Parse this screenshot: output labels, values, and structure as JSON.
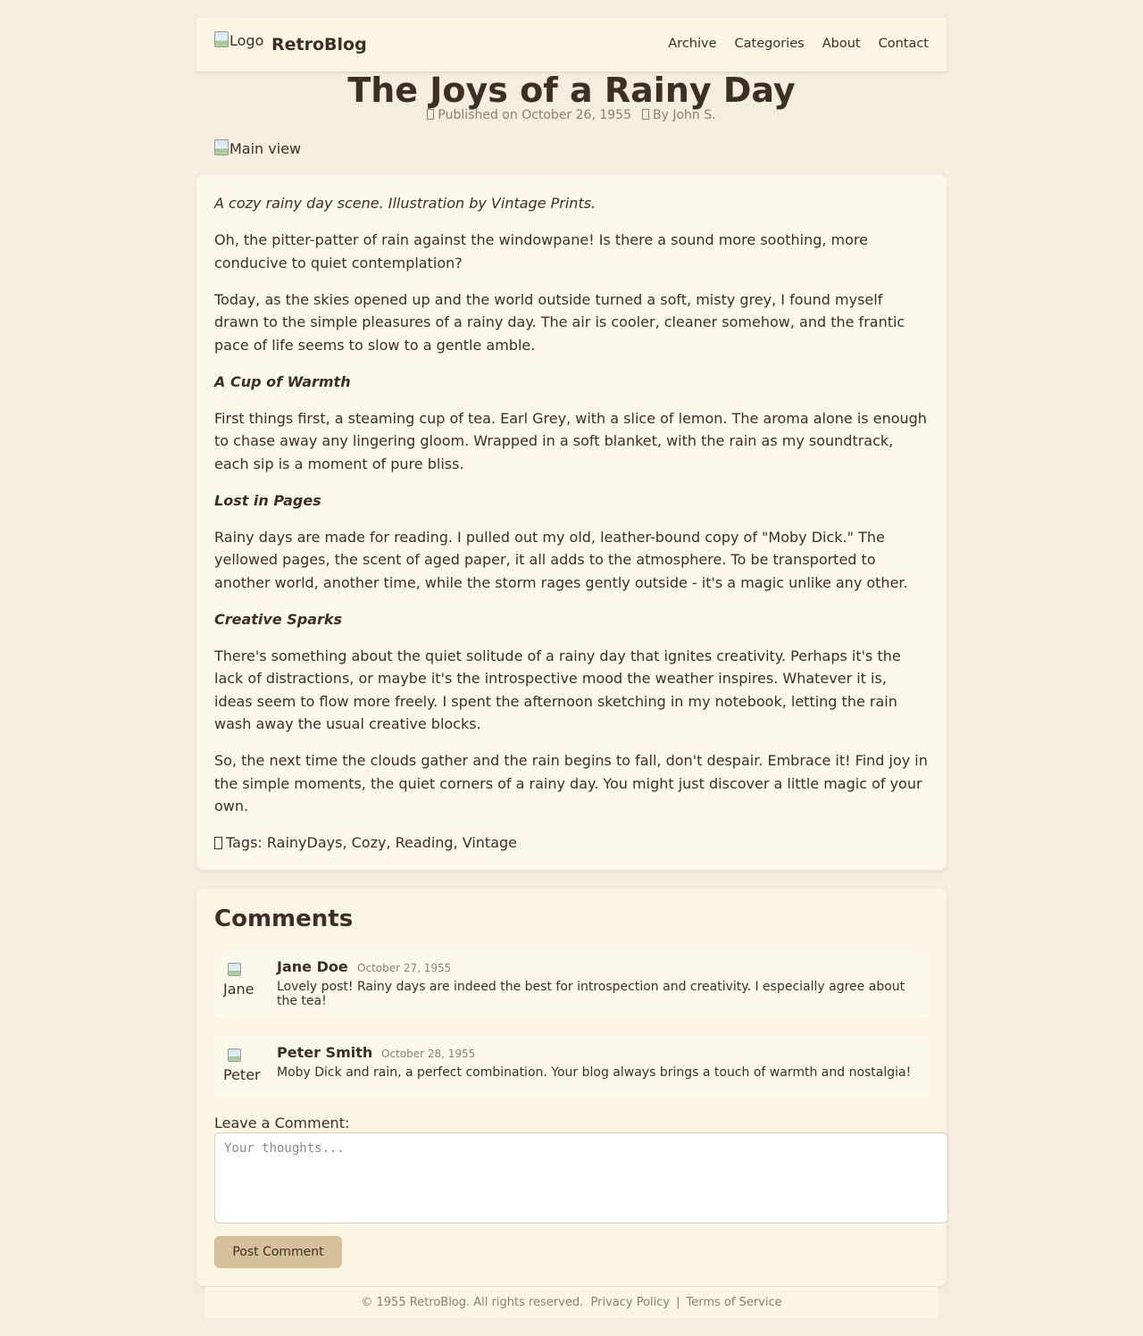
{
  "header": {
    "logo_alt": "Logo",
    "brand": "RetroBlog",
    "nav": [
      "Archive",
      "Categories",
      "About",
      "Contact"
    ]
  },
  "post": {
    "title": "The Joys of a Rainy Day",
    "published": "Published on October 26, 1955",
    "author": "By John S.",
    "main_image_alt": "Main view",
    "caption": "A cozy rainy day scene. Illustration by Vintage Prints.",
    "p1": "Oh, the pitter-patter of rain against the windowpane! Is there a sound more soothing, more conducive to quiet contemplation?",
    "p2": "Today, as the skies opened up and the world outside turned a soft, misty grey, I found myself drawn to the simple pleasures of a rainy day. The air is cooler, cleaner somehow, and the frantic pace of life seems to slow to a gentle amble.",
    "h1": "A Cup of Warmth",
    "p3": "First things first, a steaming cup of tea. Earl Grey, with a slice of lemon. The aroma alone is enough to chase away any lingering gloom. Wrapped in a soft blanket, with the rain as my soundtrack, each sip is a moment of pure bliss.",
    "h2": "Lost in Pages",
    "p4": "Rainy days are made for reading. I pulled out my old, leather-bound copy of \"Moby Dick.\" The yellowed pages, the scent of aged paper, it all adds to the atmosphere. To be transported to another world, another time, while the storm rages gently outside - it's a magic unlike any other.",
    "h3": "Creative Sparks",
    "p5": "There's something about the quiet solitude of a rainy day that ignites creativity. Perhaps it's the lack of distractions, or maybe it's the introspective mood the weather inspires. Whatever it is, ideas seem to flow more freely. I spent the afternoon sketching in my notebook, letting the rain wash away the usual creative blocks.",
    "p6": "So, the next time the clouds gather and the rain begins to fall, don't despair. Embrace it! Find joy in the simple moments, the quiet corners of a rainy day. You might just discover a little magic of your own.",
    "tags": "Tags: RainyDays, Cozy, Reading, Vintage"
  },
  "comments": {
    "heading": "Comments",
    "items": [
      {
        "avatar_alt": "Jane Doe",
        "name": "Jane Doe",
        "date": "October 27, 1955",
        "text": "Lovely post! Rainy days are indeed the best for introspection and creativity. I especially agree about the tea!"
      },
      {
        "avatar_alt": "Peter Smith",
        "name": "Peter Smith",
        "date": "October 28, 1955",
        "text": "Moby Dick and rain, a perfect combination. Your blog always brings a touch of warmth and nostalgia!"
      }
    ],
    "leave_label": "Leave a Comment:",
    "placeholder": "Your thoughts...",
    "post_button": "Post Comment"
  },
  "footer": {
    "copyright": "© 1955 RetroBlog. All rights reserved.",
    "privacy": "Privacy Policy",
    "separator": "|",
    "terms": "Terms of Service"
  },
  "colors": {
    "page_bg": "#f5eee0",
    "card_bg": "#fdf8ec",
    "header_bg": "#fdf5e3",
    "text": "#3b2f26",
    "muted": "#8a7f74",
    "button": "#d6c09a"
  },
  "icons": {
    "published": "calendar-icon",
    "author": "user-icon",
    "tags": "tag-icon"
  }
}
